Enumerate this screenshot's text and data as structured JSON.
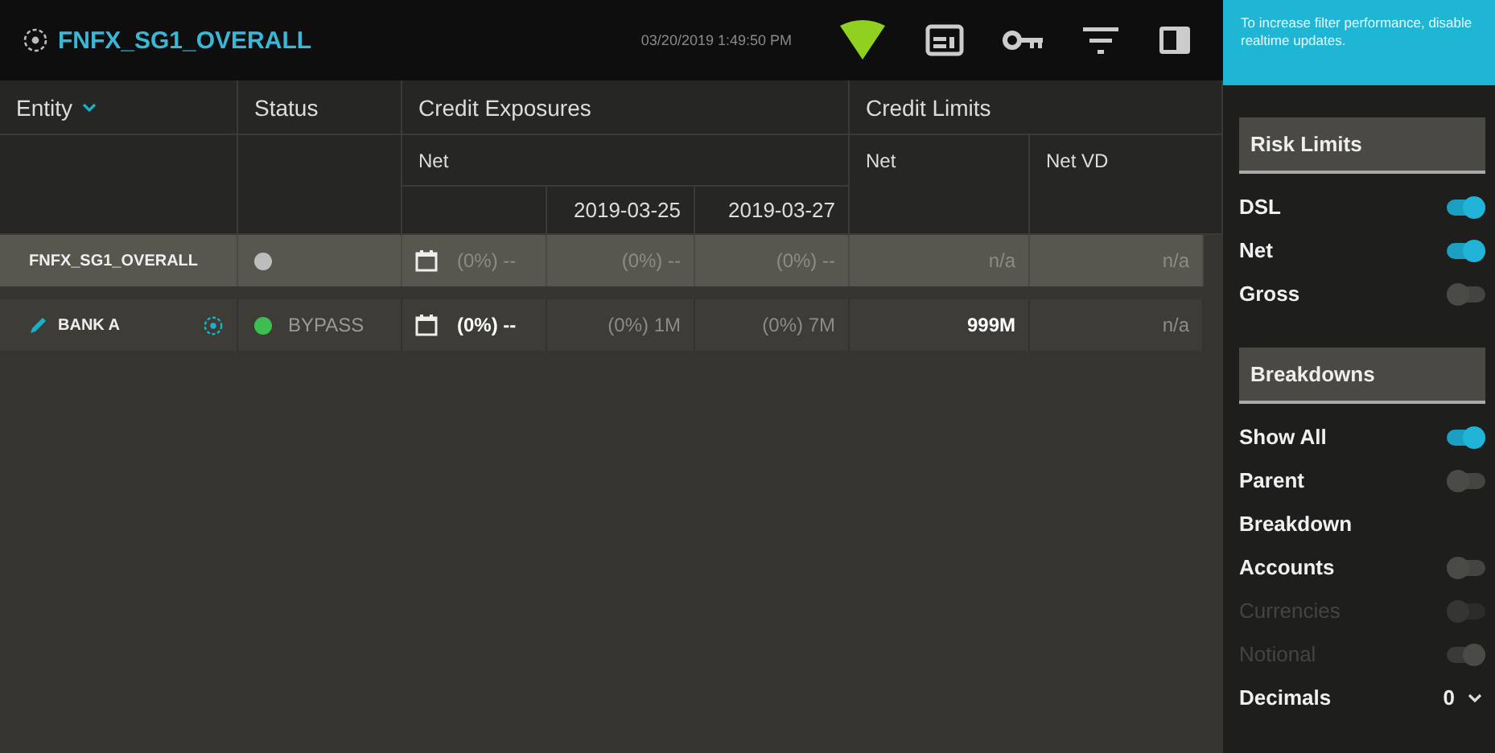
{
  "header": {
    "title": "FNFX_SG1_OVERALL",
    "timestamp": "03/20/2019 1:49:50 PM"
  },
  "notice": "To increase filter performance, disable realtime updates.",
  "table": {
    "groups": [
      {
        "label": "Entity"
      },
      {
        "label": "Status"
      },
      {
        "label": "Credit Exposures"
      },
      {
        "label": "Credit Limits"
      }
    ],
    "subheaders": [
      "Net",
      "Net",
      "Net VD"
    ],
    "dates": [
      "2019-03-25",
      "2019-03-27"
    ],
    "rows": [
      {
        "name": "FNFX_SG1_OVERALL",
        "editable": false,
        "highlighted": true,
        "color": "#bdbdbd",
        "status": "",
        "cells": [
          {
            "text": "(0%) --",
            "emphasis": false
          },
          {
            "text": "(0%) --",
            "emphasis": false
          },
          {
            "text": "(0%) --",
            "emphasis": false
          },
          {
            "text": "n/a",
            "emphasis": false
          },
          {
            "text": "n/a",
            "emphasis": false
          }
        ]
      },
      {
        "name": "BANK A",
        "editable": true,
        "highlighted": false,
        "color": "#3dbf4f",
        "status": "BYPASS",
        "cells": [
          {
            "text": "(0%) --",
            "emphasis": true
          },
          {
            "text": "(0%) 1M",
            "emphasis": false
          },
          {
            "text": "(0%) 7M",
            "emphasis": false
          },
          {
            "text": "999M",
            "emphasis": true
          },
          {
            "text": "n/a",
            "emphasis": false
          }
        ]
      }
    ]
  },
  "panel": {
    "sections": [
      {
        "title": "Risk Limits",
        "items": [
          {
            "kind": "toggle",
            "label": "DSL",
            "on": true,
            "disabled": false
          },
          {
            "kind": "toggle",
            "label": "Net",
            "on": true,
            "disabled": false
          },
          {
            "kind": "toggle",
            "label": "Gross",
            "on": false,
            "disabled": false
          }
        ]
      },
      {
        "title": "Breakdowns",
        "items": [
          {
            "kind": "toggle",
            "label": "Show All",
            "on": true,
            "disabled": false
          },
          {
            "kind": "toggle",
            "label": "Parent",
            "on": false,
            "disabled": false
          },
          {
            "kind": "label",
            "label": "Breakdown"
          },
          {
            "kind": "toggle",
            "label": "Accounts",
            "on": false,
            "disabled": false
          },
          {
            "kind": "toggle",
            "label": "Currencies",
            "on": false,
            "disabled": true
          },
          {
            "kind": "toggle",
            "label": "Notional",
            "on": true,
            "disabled": true
          },
          {
            "kind": "select",
            "label": "Decimals",
            "value": "0"
          }
        ]
      }
    ]
  }
}
